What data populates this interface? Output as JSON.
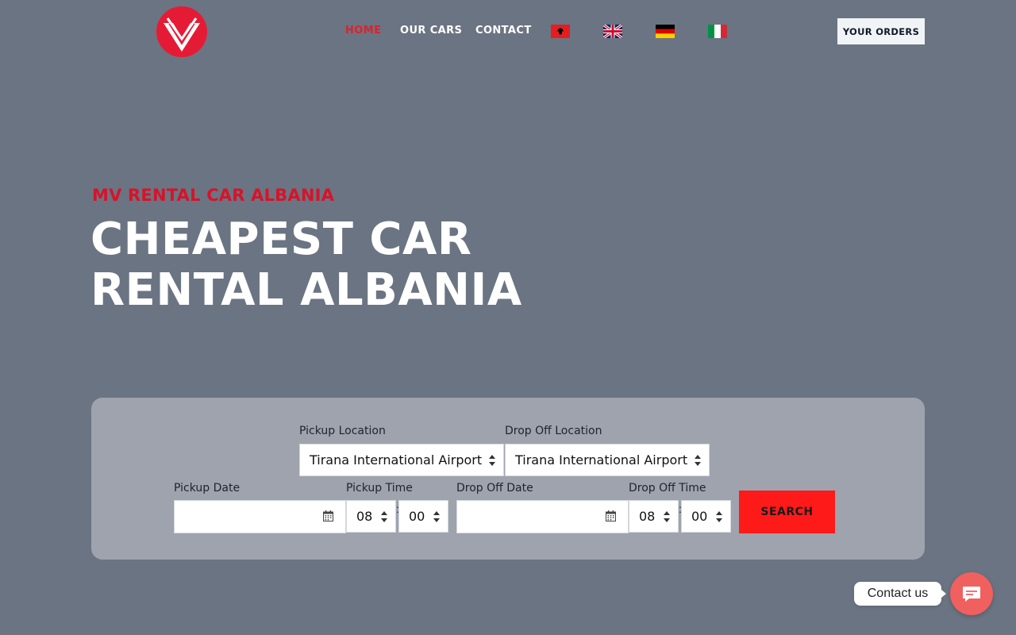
{
  "nav": {
    "home": "HOME",
    "our_cars": "OUR CARS",
    "contact": "CONTACT",
    "orders_button": "YOUR ORDERS",
    "flags": [
      "albania-flag-icon",
      "uk-flag-icon",
      "germany-flag-icon",
      "italy-flag-icon"
    ]
  },
  "hero": {
    "subtitle": "MV RENTAL CAR ALBANIA",
    "title": "CHEAPEST CAR RENTAL ALBANIA"
  },
  "search": {
    "pickup_location_label": "Pickup Location",
    "pickup_location_value": "Tirana International Airport",
    "dropoff_location_label": "Drop Off Location",
    "dropoff_location_value": "Tirana International Airport",
    "pickup_date_label": "Pickup Date",
    "pickup_date_value": "",
    "pickup_time_label": "Pickup Time",
    "pickup_hour": "08",
    "pickup_minute": "00",
    "dropoff_date_label": "Drop Off Date",
    "dropoff_date_value": "",
    "dropoff_time_label": "Drop Off Time",
    "dropoff_hour": "08",
    "dropoff_minute": "00",
    "time_separator": ":",
    "search_button": "SEARCH"
  },
  "contact_widget": {
    "label": "Contact us",
    "icon": "chat-icon"
  },
  "colors": {
    "background": "#6b7482",
    "accent_red": "#e0202b",
    "search_button": "#ff1a1a",
    "panel": "#9ea3ad",
    "contact_button": "#f0605f"
  }
}
